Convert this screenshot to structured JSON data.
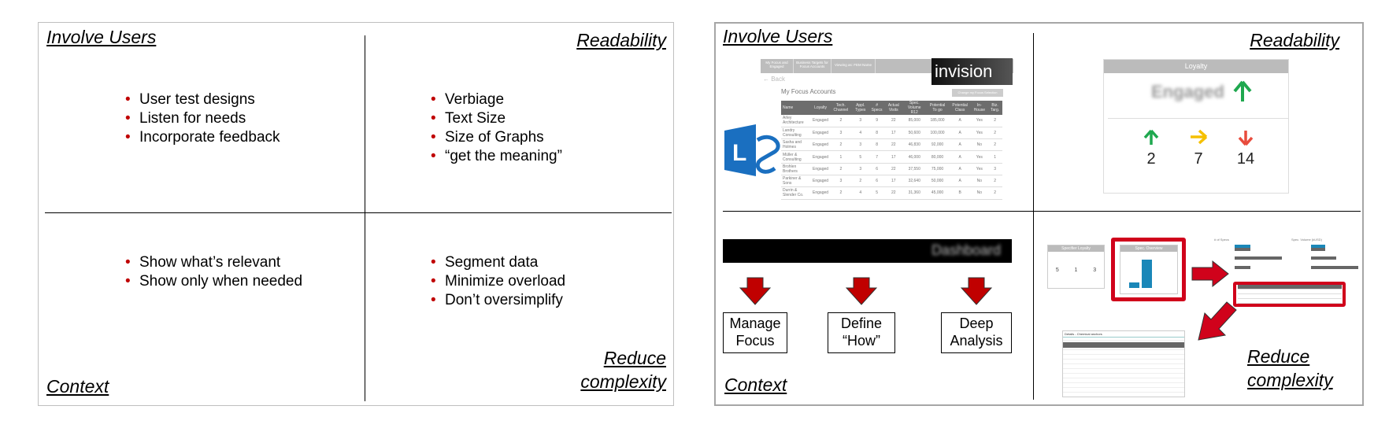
{
  "left_slide": {
    "q1": {
      "title": "Involve Users",
      "bullets": [
        "User test designs",
        "Listen for needs",
        "Incorporate feedback"
      ]
    },
    "q2": {
      "title": "Readability",
      "bullets": [
        "Verbiage",
        "Text Size",
        "Size of Graphs",
        "“get the meaning”"
      ]
    },
    "q3": {
      "title": "Context",
      "bullets": [
        "Show what’s relevant",
        "Show only when needed"
      ]
    },
    "q4": {
      "title_line1": "Reduce",
      "title_line2": "complexity",
      "bullets": [
        "Segment data",
        "Minimize overload",
        "Don’t oversimplify"
      ]
    }
  },
  "right_slide": {
    "q1": {
      "title": "Involve Users",
      "mock": {
        "nav": [
          "My Focus and Engaged",
          "Business Targets for Focus Accounts",
          "Viewing as: FEM Name"
        ],
        "back": "← Back",
        "heading": "My Focus Accounts",
        "change_button": "Change my Focus Selection",
        "columns": [
          "Name",
          "Loyalty",
          "Tech. Channel",
          "Appl. Types",
          "# Specs",
          "Actual Visits",
          "Spec. Volume R12",
          "Potential To go",
          "Potential Class",
          "In-House",
          "Biz. Targ."
        ],
        "rows": [
          [
            "Arley Architecture",
            "Engaged",
            "2",
            "3",
            "9",
            "22",
            "85,000",
            "185,000",
            "A",
            "Yes",
            "2"
          ],
          [
            "Landry Consulting",
            "Engaged",
            "3",
            "4",
            "8",
            "17",
            "50,600",
            "100,000",
            "A",
            "Yes",
            "2"
          ],
          [
            "Sasha and Holmes",
            "Engaged",
            "2",
            "3",
            "8",
            "22",
            "46,830",
            "92,000",
            "A",
            "No",
            "2"
          ],
          [
            "Müller & Consulting",
            "Engaged",
            "1",
            "5",
            "7",
            "17",
            "46,000",
            "80,000",
            "A",
            "Yes",
            "1"
          ],
          [
            "Brohlen Brothers",
            "Engaged",
            "2",
            "3",
            "6",
            "22",
            "37,550",
            "75,000",
            "A",
            "Yes",
            "3"
          ],
          [
            "Parkiner & Sons",
            "Engaged",
            "3",
            "2",
            "6",
            "17",
            "32,640",
            "50,000",
            "A",
            "No",
            "2"
          ],
          [
            "Durrin & Slender Co.",
            "Engaged",
            "2",
            "4",
            "5",
            "22",
            "31,360",
            "45,000",
            "B",
            "No",
            "2"
          ]
        ]
      },
      "logo_invision": "invision",
      "logo_lync": "L"
    },
    "q2": {
      "title": "Readability",
      "panel_title": "Loyalty",
      "status": "Engaged",
      "counts": [
        {
          "value": "2",
          "trend": "up",
          "color": "#1fa84f"
        },
        {
          "value": "7",
          "trend": "right",
          "color": "#f5c000"
        },
        {
          "value": "14",
          "trend": "down",
          "color": "#e84c3d"
        }
      ]
    },
    "q3": {
      "title": "Context",
      "bar_active": "Dashboard",
      "boxes": [
        [
          "Manage",
          "Focus"
        ],
        [
          "Define",
          "“How”"
        ],
        [
          "Deep",
          "Analysis"
        ]
      ]
    },
    "q4": {
      "title_line1": "Reduce",
      "title_line2": "complexity",
      "panel1": "Specifier Loyalty",
      "panel2": "Spec. Overview",
      "chart1": "# of Specs",
      "chart2": "Spec. Volume (kUSD)",
      "dialog": "Details - Chemical anchors",
      "mini_counts": [
        "5",
        "1",
        "3"
      ]
    }
  },
  "colors": {
    "accent_red": "#c00000",
    "frame_red": "#d0021b",
    "bar_blue": "#1a87b8"
  }
}
